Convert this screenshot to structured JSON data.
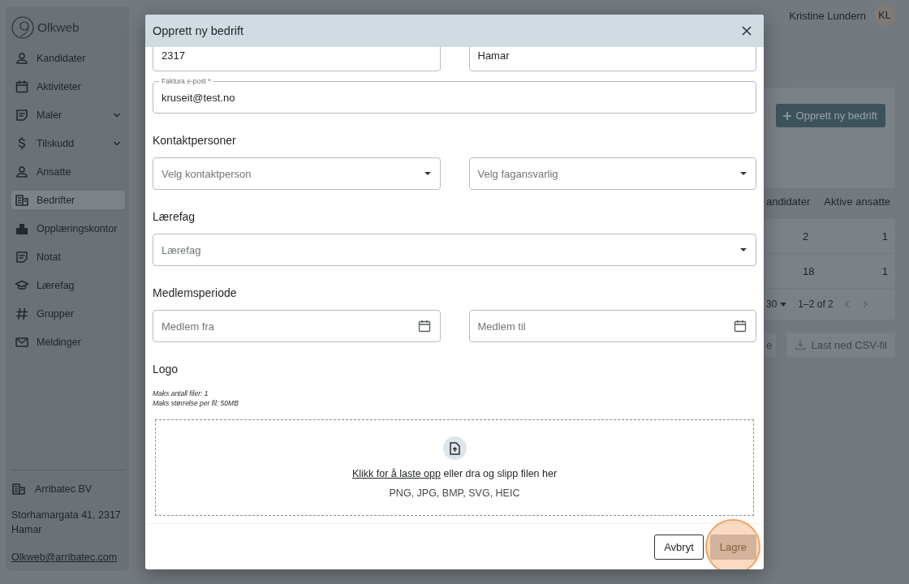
{
  "app": {
    "logo": "Olkweb"
  },
  "sidebar": {
    "items": [
      {
        "label": "Kandidater",
        "kind": "link",
        "selected": false
      },
      {
        "label": "Aktiviteter",
        "kind": "link",
        "selected": false
      },
      {
        "label": "Maler",
        "kind": "group",
        "expanded": false,
        "selected": false
      },
      {
        "label": "Tilskudd",
        "kind": "group",
        "expanded": false,
        "selected": false
      },
      {
        "label": "Ansatte",
        "kind": "link",
        "selected": false
      },
      {
        "label": "Bedrifter",
        "kind": "link",
        "selected": true
      },
      {
        "label": "Opplæringskontor",
        "kind": "link",
        "selected": false
      },
      {
        "label": "Notat",
        "kind": "link",
        "selected": false
      },
      {
        "label": "Lærefag",
        "kind": "link",
        "selected": false
      },
      {
        "label": "Grupper",
        "kind": "link",
        "selected": false
      },
      {
        "label": "Meldinger",
        "kind": "link",
        "selected": false
      }
    ]
  },
  "organization": {
    "name": "Arribatec BV",
    "address": "Storhamargata 41, 2317 Hamar",
    "email": "Olkweb@arribatec.com"
  },
  "user": {
    "name": "Kristine Lundern",
    "initials": "KL"
  },
  "background": {
    "create_button": "Opprett ny bedrift",
    "table": {
      "columns": [
        "andidater",
        "Aktive ansatte"
      ],
      "rows": [
        [
          "2",
          "1"
        ],
        [
          "18",
          "1"
        ]
      ]
    },
    "pagination": {
      "page_size": "30",
      "range": "1–2 of 2"
    },
    "buttons": [
      "e",
      "Last ned CSV-fil"
    ]
  },
  "dialog": {
    "title": "Opprett ny bedrift",
    "top_fields": [
      {
        "value": "2317"
      },
      {
        "value": "Hamar"
      }
    ],
    "invoice_email": {
      "label": "Faktura e-post *",
      "value": "kruseit@test.no"
    },
    "sections": [
      {
        "heading": "Kontaktpersoner",
        "kind": "select",
        "fields": [
          {
            "placeholder": "Velg kontaktperson"
          },
          {
            "placeholder": "Velg fagansvarlig"
          }
        ]
      },
      {
        "heading": "Lærefag",
        "kind": "select",
        "fields": [
          {
            "placeholder": "Lærefag"
          }
        ]
      },
      {
        "heading": "Medlemsperiode",
        "kind": "date",
        "fields": [
          {
            "placeholder": "Medlem fra"
          },
          {
            "placeholder": "Medlem til"
          }
        ]
      }
    ],
    "logo": {
      "heading": "Logo",
      "notes": [
        "Maks antall filer: 1",
        "Maks størrelse per fil: 50MB"
      ],
      "upload_link": "Klikk for å laste opp",
      "upload_text": "eller dra og slipp filen her",
      "formats": "PNG, JPG, BMP, SVG, HEIC"
    },
    "buttons": [
      {
        "label": "Avbryt",
        "kind": "secondary",
        "disabled": false,
        "highlighted": false
      },
      {
        "label": "Lagre",
        "kind": "primary",
        "disabled": true,
        "highlighted": true
      }
    ]
  }
}
